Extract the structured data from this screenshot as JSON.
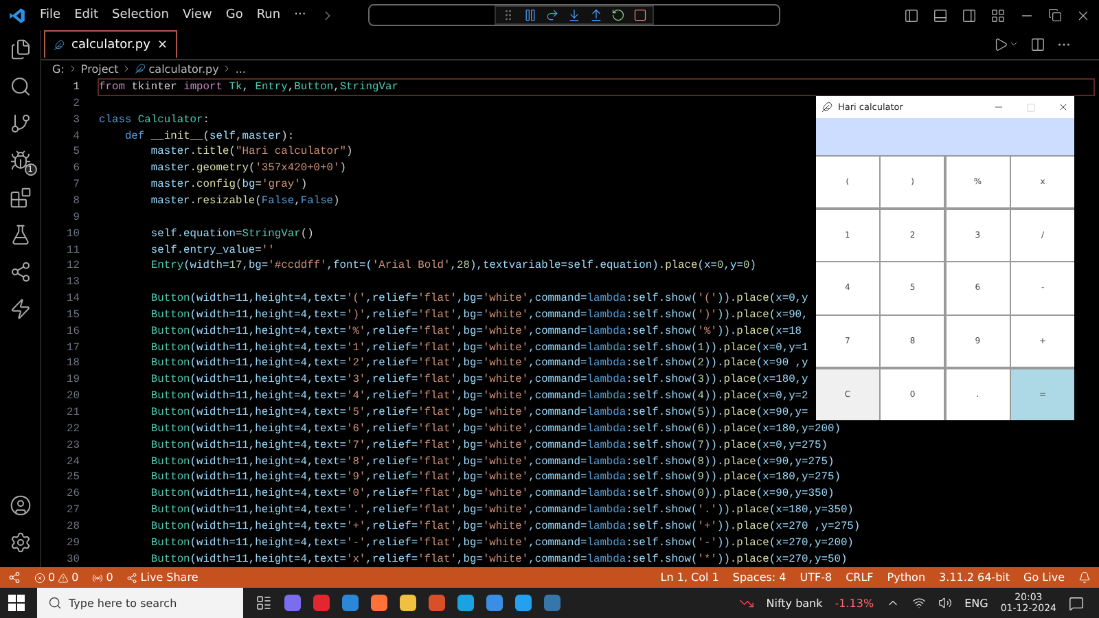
{
  "menu": [
    "File",
    "Edit",
    "Selection",
    "View",
    "Go",
    "Run",
    "···"
  ],
  "activity_bar": {
    "debug_badge": "1"
  },
  "tabs": [
    {
      "label": "calculator.py",
      "selected": true,
      "close": "×"
    }
  ],
  "breadcrumb": [
    "G:",
    "Project",
    "calculator.py",
    "..."
  ],
  "editor": {
    "lines": [
      {
        "number": "1",
        "current": true,
        "tokens": [
          {
            "kind": "k",
            "text": "from"
          },
          {
            "kind": "p",
            "text": " tkinter "
          },
          {
            "kind": "k",
            "text": "import"
          },
          {
            "kind": "c",
            "text": " Tk"
          },
          {
            "kind": "p",
            "text": ", "
          },
          {
            "kind": "c",
            "text": "Entry"
          },
          {
            "kind": "p",
            "text": ","
          },
          {
            "kind": "c",
            "text": "Button"
          },
          {
            "kind": "p",
            "text": ","
          },
          {
            "kind": "c",
            "text": "StringVar"
          }
        ]
      },
      {
        "number": "2",
        "current": false
      },
      {
        "number": "3",
        "current": false,
        "tokens": [
          {
            "kind": "b",
            "text": "class"
          },
          {
            "kind": "c",
            "text": " Calculator"
          },
          {
            "kind": "p",
            "text": ":"
          }
        ]
      },
      {
        "number": "4",
        "current": false,
        "tokens": [
          {
            "kind": "b",
            "text": "    def"
          },
          {
            "kind": "f",
            "text": " __init__"
          },
          {
            "kind": "p",
            "text": "("
          },
          {
            "kind": "v",
            "text": "self"
          },
          {
            "kind": "p",
            "text": ","
          },
          {
            "kind": "v",
            "text": "master"
          },
          {
            "kind": "p",
            "text": "):"
          }
        ]
      },
      {
        "number": "5",
        "current": false,
        "tokens": [
          {
            "kind": "v",
            "text": "        master"
          },
          {
            "kind": "p",
            "text": "."
          },
          {
            "kind": "f",
            "text": "title"
          },
          {
            "kind": "p",
            "text": "("
          },
          {
            "kind": "s",
            "text": "\"Hari calculator\""
          },
          {
            "kind": "p",
            "text": ")"
          }
        ]
      },
      {
        "number": "6",
        "current": false,
        "tokens": [
          {
            "kind": "v",
            "text": "        master"
          },
          {
            "kind": "p",
            "text": "."
          },
          {
            "kind": "f",
            "text": "geometry"
          },
          {
            "kind": "p",
            "text": "("
          },
          {
            "kind": "s",
            "text": "'357x420+0+0'"
          },
          {
            "kind": "p",
            "text": ")"
          }
        ]
      },
      {
        "number": "7",
        "current": false,
        "tokens": [
          {
            "kind": "v",
            "text": "        master"
          },
          {
            "kind": "p",
            "text": "."
          },
          {
            "kind": "f",
            "text": "config"
          },
          {
            "kind": "p",
            "text": "("
          },
          {
            "kind": "v",
            "text": "bg"
          },
          {
            "kind": "p",
            "text": "="
          },
          {
            "kind": "s",
            "text": "'gray'"
          },
          {
            "kind": "p",
            "text": ")"
          }
        ]
      },
      {
        "number": "8",
        "current": false,
        "tokens": [
          {
            "kind": "v",
            "text": "        master"
          },
          {
            "kind": "p",
            "text": "."
          },
          {
            "kind": "f",
            "text": "resizable"
          },
          {
            "kind": "p",
            "text": "("
          },
          {
            "kind": "b",
            "text": "False"
          },
          {
            "kind": "p",
            "text": ","
          },
          {
            "kind": "b",
            "text": "False"
          },
          {
            "kind": "p",
            "text": ")"
          }
        ]
      },
      {
        "number": "9",
        "current": false
      },
      {
        "number": "10",
        "current": false,
        "tokens": [
          {
            "kind": "v",
            "text": "        self.equation"
          },
          {
            "kind": "p",
            "text": "="
          },
          {
            "kind": "c",
            "text": "StringVar"
          },
          {
            "kind": "p",
            "text": "()"
          }
        ]
      },
      {
        "number": "11",
        "current": false,
        "tokens": [
          {
            "kind": "v",
            "text": "        self.entry_value"
          },
          {
            "kind": "p",
            "text": "="
          },
          {
            "kind": "s",
            "text": "''"
          }
        ]
      },
      {
        "number": "12",
        "current": false,
        "tokens": [
          {
            "kind": "c",
            "text": "        Entry"
          },
          {
            "kind": "v",
            "text": "(width="
          },
          {
            "kind": "n",
            "text": "17"
          },
          {
            "kind": "v",
            "text": ",bg="
          },
          {
            "kind": "s",
            "text": "'#ccddff'"
          },
          {
            "kind": "v",
            "text": ",font=("
          },
          {
            "kind": "s",
            "text": "'Arial Bold'"
          },
          {
            "kind": "v",
            "text": ","
          },
          {
            "kind": "n",
            "text": "28"
          },
          {
            "kind": "v",
            "text": "),textvariable=self.equation)."
          },
          {
            "kind": "f",
            "text": "place"
          },
          {
            "kind": "v",
            "text": "(x="
          },
          {
            "kind": "n",
            "text": "0"
          },
          {
            "kind": "v",
            "text": ",y="
          },
          {
            "kind": "n",
            "text": "0"
          },
          {
            "kind": "v",
            "text": ")"
          }
        ]
      },
      {
        "number": "13",
        "current": false
      },
      {
        "number": "14",
        "current": false,
        "tokens": [
          {
            "kind": "c",
            "text": "        Button"
          },
          {
            "kind": "v",
            "text": "(width=11,height=4,text="
          },
          {
            "kind": "s",
            "text": "'('"
          },
          {
            "kind": "v",
            "text": ",relief="
          },
          {
            "kind": "s",
            "text": "'flat'"
          },
          {
            "kind": "v",
            "text": ",bg="
          },
          {
            "kind": "s",
            "text": "'white'"
          },
          {
            "kind": "v",
            "text": ",command="
          },
          {
            "kind": "b",
            "text": "lambda"
          },
          {
            "kind": "v",
            "text": ":self.show("
          },
          {
            "kind": "s",
            "text": "'('"
          },
          {
            "kind": "v",
            "text": "))."
          },
          {
            "kind": "f",
            "text": "place"
          },
          {
            "kind": "v",
            "text": "(x=0,y"
          }
        ]
      },
      {
        "number": "15",
        "current": false,
        "tokens": [
          {
            "kind": "c",
            "text": "        Button"
          },
          {
            "kind": "v",
            "text": "(width=11,height=4,text="
          },
          {
            "kind": "s",
            "text": "')'"
          },
          {
            "kind": "v",
            "text": ",relief="
          },
          {
            "kind": "s",
            "text": "'flat'"
          },
          {
            "kind": "v",
            "text": ",bg="
          },
          {
            "kind": "s",
            "text": "'white'"
          },
          {
            "kind": "v",
            "text": ",command="
          },
          {
            "kind": "b",
            "text": "lambda"
          },
          {
            "kind": "v",
            "text": ":self.show("
          },
          {
            "kind": "s",
            "text": "')'"
          },
          {
            "kind": "v",
            "text": "))."
          },
          {
            "kind": "f",
            "text": "place"
          },
          {
            "kind": "v",
            "text": "(x=90,"
          }
        ]
      },
      {
        "number": "16",
        "current": false,
        "tokens": [
          {
            "kind": "c",
            "text": "        Button"
          },
          {
            "kind": "v",
            "text": "(width=11,height=4,text="
          },
          {
            "kind": "s",
            "text": "'%'"
          },
          {
            "kind": "v",
            "text": ",relief="
          },
          {
            "kind": "s",
            "text": "'flat'"
          },
          {
            "kind": "v",
            "text": ",bg="
          },
          {
            "kind": "s",
            "text": "'white'"
          },
          {
            "kind": "v",
            "text": ",command="
          },
          {
            "kind": "b",
            "text": "lambda"
          },
          {
            "kind": "v",
            "text": ":self.show("
          },
          {
            "kind": "s",
            "text": "'%'"
          },
          {
            "kind": "v",
            "text": "))."
          },
          {
            "kind": "f",
            "text": "place"
          },
          {
            "kind": "v",
            "text": "(x=18"
          }
        ]
      },
      {
        "number": "17",
        "current": false,
        "tokens": [
          {
            "kind": "c",
            "text": "        Button"
          },
          {
            "kind": "v",
            "text": "(width=11,height=4,text="
          },
          {
            "kind": "s",
            "text": "'1'"
          },
          {
            "kind": "v",
            "text": ",relief="
          },
          {
            "kind": "s",
            "text": "'flat'"
          },
          {
            "kind": "v",
            "text": ",bg="
          },
          {
            "kind": "s",
            "text": "'white'"
          },
          {
            "kind": "v",
            "text": ",command="
          },
          {
            "kind": "b",
            "text": "lambda"
          },
          {
            "kind": "v",
            "text": ":self.show("
          },
          {
            "kind": "n",
            "text": "1"
          },
          {
            "kind": "v",
            "text": "))."
          },
          {
            "kind": "f",
            "text": "place"
          },
          {
            "kind": "v",
            "text": "(x=0,y=1"
          }
        ]
      },
      {
        "number": "18",
        "current": false,
        "tokens": [
          {
            "kind": "c",
            "text": "        Button"
          },
          {
            "kind": "v",
            "text": "(width=11,height=4,text="
          },
          {
            "kind": "s",
            "text": "'2'"
          },
          {
            "kind": "v",
            "text": ",relief="
          },
          {
            "kind": "s",
            "text": "'flat'"
          },
          {
            "kind": "v",
            "text": ",bg="
          },
          {
            "kind": "s",
            "text": "'white'"
          },
          {
            "kind": "v",
            "text": ",command="
          },
          {
            "kind": "b",
            "text": "lambda"
          },
          {
            "kind": "v",
            "text": ":self.show("
          },
          {
            "kind": "n",
            "text": "2"
          },
          {
            "kind": "v",
            "text": "))."
          },
          {
            "kind": "f",
            "text": "place"
          },
          {
            "kind": "v",
            "text": "(x=90 ,y"
          }
        ]
      },
      {
        "number": "19",
        "current": false,
        "tokens": [
          {
            "kind": "c",
            "text": "        Button"
          },
          {
            "kind": "v",
            "text": "(width=11,height=4,text="
          },
          {
            "kind": "s",
            "text": "'3'"
          },
          {
            "kind": "v",
            "text": ",relief="
          },
          {
            "kind": "s",
            "text": "'flat'"
          },
          {
            "kind": "v",
            "text": ",bg="
          },
          {
            "kind": "s",
            "text": "'white'"
          },
          {
            "kind": "v",
            "text": ",command="
          },
          {
            "kind": "b",
            "text": "lambda"
          },
          {
            "kind": "v",
            "text": ":self.show("
          },
          {
            "kind": "n",
            "text": "3"
          },
          {
            "kind": "v",
            "text": "))."
          },
          {
            "kind": "f",
            "text": "place"
          },
          {
            "kind": "v",
            "text": "(x=180,y"
          }
        ]
      },
      {
        "number": "20",
        "current": false,
        "tokens": [
          {
            "kind": "c",
            "text": "        Button"
          },
          {
            "kind": "v",
            "text": "(width=11,height=4,text="
          },
          {
            "kind": "s",
            "text": "'4'"
          },
          {
            "kind": "v",
            "text": ",relief="
          },
          {
            "kind": "s",
            "text": "'flat'"
          },
          {
            "kind": "v",
            "text": ",bg="
          },
          {
            "kind": "s",
            "text": "'white'"
          },
          {
            "kind": "v",
            "text": ",command="
          },
          {
            "kind": "b",
            "text": "lambda"
          },
          {
            "kind": "v",
            "text": ":self.show("
          },
          {
            "kind": "n",
            "text": "4"
          },
          {
            "kind": "v",
            "text": "))."
          },
          {
            "kind": "f",
            "text": "place"
          },
          {
            "kind": "v",
            "text": "(x=0,y=2"
          }
        ]
      },
      {
        "number": "21",
        "current": false,
        "tokens": [
          {
            "kind": "c",
            "text": "        Button"
          },
          {
            "kind": "v",
            "text": "(width=11,height=4,text="
          },
          {
            "kind": "s",
            "text": "'5'"
          },
          {
            "kind": "v",
            "text": ",relief="
          },
          {
            "kind": "s",
            "text": "'flat'"
          },
          {
            "kind": "v",
            "text": ",bg="
          },
          {
            "kind": "s",
            "text": "'white'"
          },
          {
            "kind": "v",
            "text": ",command="
          },
          {
            "kind": "b",
            "text": "lambda"
          },
          {
            "kind": "v",
            "text": ":self.show("
          },
          {
            "kind": "n",
            "text": "5"
          },
          {
            "kind": "v",
            "text": "))."
          },
          {
            "kind": "f",
            "text": "place"
          },
          {
            "kind": "v",
            "text": "(x=90,y="
          }
        ]
      },
      {
        "number": "22",
        "current": false,
        "tokens": [
          {
            "kind": "c",
            "text": "        Button"
          },
          {
            "kind": "v",
            "text": "(width=11,height=4,text="
          },
          {
            "kind": "s",
            "text": "'6'"
          },
          {
            "kind": "v",
            "text": ",relief="
          },
          {
            "kind": "s",
            "text": "'flat'"
          },
          {
            "kind": "v",
            "text": ",bg="
          },
          {
            "kind": "s",
            "text": "'white'"
          },
          {
            "kind": "v",
            "text": ",command="
          },
          {
            "kind": "b",
            "text": "lambda"
          },
          {
            "kind": "v",
            "text": ":self.show("
          },
          {
            "kind": "n",
            "text": "6"
          },
          {
            "kind": "v",
            "text": "))."
          },
          {
            "kind": "f",
            "text": "place"
          },
          {
            "kind": "v",
            "text": "(x=180,y=200)"
          }
        ]
      },
      {
        "number": "23",
        "current": false,
        "tokens": [
          {
            "kind": "c",
            "text": "        Button"
          },
          {
            "kind": "v",
            "text": "(width=11,height=4,text="
          },
          {
            "kind": "s",
            "text": "'7'"
          },
          {
            "kind": "v",
            "text": ",relief="
          },
          {
            "kind": "s",
            "text": "'flat'"
          },
          {
            "kind": "v",
            "text": ",bg="
          },
          {
            "kind": "s",
            "text": "'white'"
          },
          {
            "kind": "v",
            "text": ",command="
          },
          {
            "kind": "b",
            "text": "lambda"
          },
          {
            "kind": "v",
            "text": ":self.show("
          },
          {
            "kind": "n",
            "text": "7"
          },
          {
            "kind": "v",
            "text": "))."
          },
          {
            "kind": "f",
            "text": "place"
          },
          {
            "kind": "v",
            "text": "(x=0,y=275)"
          }
        ]
      },
      {
        "number": "24",
        "current": false,
        "tokens": [
          {
            "kind": "c",
            "text": "        Button"
          },
          {
            "kind": "v",
            "text": "(width=11,height=4,text="
          },
          {
            "kind": "s",
            "text": "'8'"
          },
          {
            "kind": "v",
            "text": ",relief="
          },
          {
            "kind": "s",
            "text": "'flat'"
          },
          {
            "kind": "v",
            "text": ",bg="
          },
          {
            "kind": "s",
            "text": "'white'"
          },
          {
            "kind": "v",
            "text": ",command="
          },
          {
            "kind": "b",
            "text": "lambda"
          },
          {
            "kind": "v",
            "text": ":self.show("
          },
          {
            "kind": "n",
            "text": "8"
          },
          {
            "kind": "v",
            "text": "))."
          },
          {
            "kind": "f",
            "text": "place"
          },
          {
            "kind": "v",
            "text": "(x=90,y=275)"
          }
        ]
      },
      {
        "number": "25",
        "current": false,
        "tokens": [
          {
            "kind": "c",
            "text": "        Button"
          },
          {
            "kind": "v",
            "text": "(width=11,height=4,text="
          },
          {
            "kind": "s",
            "text": "'9'"
          },
          {
            "kind": "v",
            "text": ",relief="
          },
          {
            "kind": "s",
            "text": "'flat'"
          },
          {
            "kind": "v",
            "text": ",bg="
          },
          {
            "kind": "s",
            "text": "'white'"
          },
          {
            "kind": "v",
            "text": ",command="
          },
          {
            "kind": "b",
            "text": "lambda"
          },
          {
            "kind": "v",
            "text": ":self.show("
          },
          {
            "kind": "n",
            "text": "9"
          },
          {
            "kind": "v",
            "text": "))."
          },
          {
            "kind": "f",
            "text": "place"
          },
          {
            "kind": "v",
            "text": "(x=180,y=275)"
          }
        ]
      },
      {
        "number": "26",
        "current": false,
        "tokens": [
          {
            "kind": "c",
            "text": "        Button"
          },
          {
            "kind": "v",
            "text": "(width=11,height=4,text="
          },
          {
            "kind": "s",
            "text": "'0'"
          },
          {
            "kind": "v",
            "text": ",relief="
          },
          {
            "kind": "s",
            "text": "'flat'"
          },
          {
            "kind": "v",
            "text": ",bg="
          },
          {
            "kind": "s",
            "text": "'white'"
          },
          {
            "kind": "v",
            "text": ",command="
          },
          {
            "kind": "b",
            "text": "lambda"
          },
          {
            "kind": "v",
            "text": ":self.show("
          },
          {
            "kind": "n",
            "text": "0"
          },
          {
            "kind": "v",
            "text": "))."
          },
          {
            "kind": "f",
            "text": "place"
          },
          {
            "kind": "v",
            "text": "(x=90,y=350)"
          }
        ]
      },
      {
        "number": "27",
        "current": false,
        "tokens": [
          {
            "kind": "c",
            "text": "        Button"
          },
          {
            "kind": "v",
            "text": "(width=11,height=4,text="
          },
          {
            "kind": "s",
            "text": "'.'"
          },
          {
            "kind": "v",
            "text": ",relief="
          },
          {
            "kind": "s",
            "text": "'flat'"
          },
          {
            "kind": "v",
            "text": ",bg="
          },
          {
            "kind": "s",
            "text": "'white'"
          },
          {
            "kind": "v",
            "text": ",command="
          },
          {
            "kind": "b",
            "text": "lambda"
          },
          {
            "kind": "v",
            "text": ":self.show("
          },
          {
            "kind": "s",
            "text": "'.'"
          },
          {
            "kind": "v",
            "text": "))."
          },
          {
            "kind": "f",
            "text": "place"
          },
          {
            "kind": "v",
            "text": "(x=180,y=350)"
          }
        ]
      },
      {
        "number": "28",
        "current": false,
        "tokens": [
          {
            "kind": "c",
            "text": "        Button"
          },
          {
            "kind": "v",
            "text": "(width=11,height=4,text="
          },
          {
            "kind": "s",
            "text": "'+'"
          },
          {
            "kind": "v",
            "text": ",relief="
          },
          {
            "kind": "s",
            "text": "'flat'"
          },
          {
            "kind": "v",
            "text": ",bg="
          },
          {
            "kind": "s",
            "text": "'white'"
          },
          {
            "kind": "v",
            "text": ",command="
          },
          {
            "kind": "b",
            "text": "lambda"
          },
          {
            "kind": "v",
            "text": ":self.show("
          },
          {
            "kind": "s",
            "text": "'+'"
          },
          {
            "kind": "v",
            "text": "))."
          },
          {
            "kind": "f",
            "text": "place"
          },
          {
            "kind": "v",
            "text": "(x=270 ,y=275)"
          }
        ]
      },
      {
        "number": "29",
        "current": false,
        "tokens": [
          {
            "kind": "c",
            "text": "        Button"
          },
          {
            "kind": "v",
            "text": "(width=11,height=4,text="
          },
          {
            "kind": "s",
            "text": "'-'"
          },
          {
            "kind": "v",
            "text": ",relief="
          },
          {
            "kind": "s",
            "text": "'flat'"
          },
          {
            "kind": "v",
            "text": ",bg="
          },
          {
            "kind": "s",
            "text": "'white'"
          },
          {
            "kind": "v",
            "text": ",command="
          },
          {
            "kind": "b",
            "text": "lambda"
          },
          {
            "kind": "v",
            "text": ":self.show("
          },
          {
            "kind": "s",
            "text": "'-'"
          },
          {
            "kind": "v",
            "text": "))."
          },
          {
            "kind": "f",
            "text": "place"
          },
          {
            "kind": "v",
            "text": "(x=270,y=200)"
          }
        ]
      },
      {
        "number": "30",
        "current": false,
        "tokens": [
          {
            "kind": "c",
            "text": "        Button"
          },
          {
            "kind": "v",
            "text": "(width=11,height=4,text="
          },
          {
            "kind": "s",
            "text": "'x'"
          },
          {
            "kind": "v",
            "text": ",relief="
          },
          {
            "kind": "s",
            "text": "'flat'"
          },
          {
            "kind": "v",
            "text": ",bg="
          },
          {
            "kind": "s",
            "text": "'white'"
          },
          {
            "kind": "v",
            "text": ",command="
          },
          {
            "kind": "b",
            "text": "lambda"
          },
          {
            "kind": "v",
            "text": ":self.show("
          },
          {
            "kind": "s",
            "text": "'*'"
          },
          {
            "kind": "v",
            "text": "))."
          },
          {
            "kind": "f",
            "text": "place"
          },
          {
            "kind": "v",
            "text": "(x=270,y=50)"
          }
        ]
      }
    ]
  },
  "calculator": {
    "title": "Hari calculator",
    "buttons": [
      {
        "label": "(",
        "kind": "plain"
      },
      {
        "label": ")",
        "kind": "plain"
      },
      {
        "label": "%",
        "kind": "plain"
      },
      {
        "label": "x",
        "kind": "plain"
      },
      {
        "label": "1",
        "kind": "plain"
      },
      {
        "label": "2",
        "kind": "plain"
      },
      {
        "label": "3",
        "kind": "plain"
      },
      {
        "label": "/",
        "kind": "plain"
      },
      {
        "label": "4",
        "kind": "plain"
      },
      {
        "label": "5",
        "kind": "plain"
      },
      {
        "label": "6",
        "kind": "plain"
      },
      {
        "label": "-",
        "kind": "plain"
      },
      {
        "label": "7",
        "kind": "plain"
      },
      {
        "label": "8",
        "kind": "plain"
      },
      {
        "label": "9",
        "kind": "plain"
      },
      {
        "label": "+",
        "kind": "plain"
      },
      {
        "label": "C",
        "kind": "clear"
      },
      {
        "label": "0",
        "kind": "plain"
      },
      {
        "label": ".",
        "kind": "plain"
      },
      {
        "label": "=",
        "kind": "equals"
      }
    ]
  },
  "status_bar": {
    "errors": "0",
    "warnings": "0",
    "ports": "0",
    "live_share": "Live Share",
    "right": [
      "Ln 1, Col 1",
      "Spaces: 4",
      "UTF-8",
      "CRLF",
      "Python",
      "3.11.2 64-bit",
      "Go Live"
    ]
  },
  "taskbar": {
    "search": {
      "placeholder": "Type here to search"
    },
    "stock": {
      "name": "Nifty bank",
      "change": "-1.13%"
    },
    "language": "ENG",
    "time": "20:03",
    "date": "01-12-2024"
  }
}
